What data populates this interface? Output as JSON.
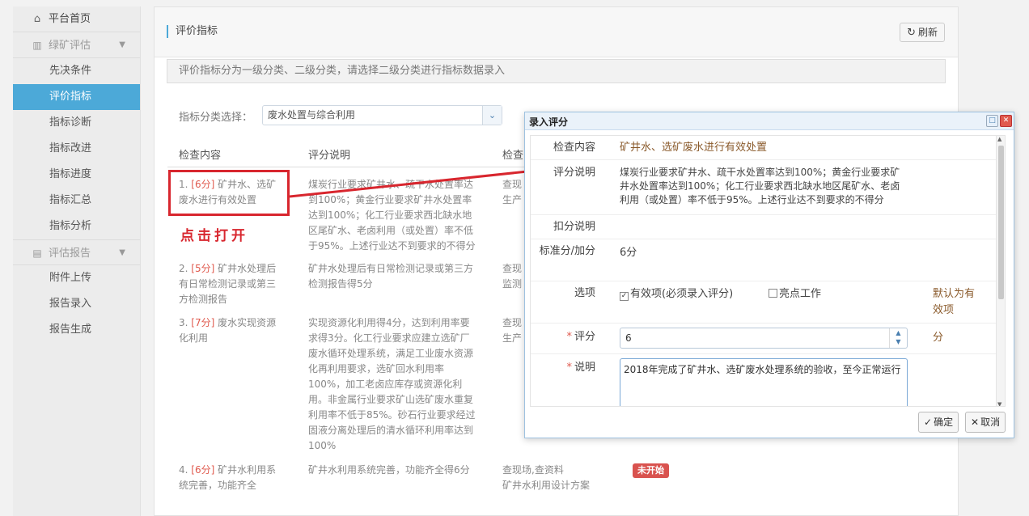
{
  "sidebar": {
    "home": "平台首页",
    "group1": "绿矿评估",
    "group1_items": [
      "先决条件",
      "评价指标",
      "指标诊断",
      "指标改进",
      "指标进度",
      "指标汇总",
      "指标分析"
    ],
    "group2": "评估报告",
    "group2_items": [
      "附件上传",
      "报告录入",
      "报告生成"
    ],
    "active_item": "评价指标"
  },
  "main": {
    "title": "评价指标",
    "refresh_label": "刷新",
    "notice": "评价指标分为一级分类、二级分类，请选择二级分类进行指标数据录入",
    "filter_label": "指标分类选择：",
    "filter_value": "废水处置与综合利用",
    "columns": [
      "检查内容",
      "评分说明",
      "检查"
    ],
    "rows": [
      {
        "num": "1.",
        "score": "[6分]",
        "content": "矿井水、选矿废水进行有效处置",
        "desc": "煤炭行业要求矿井水、疏干水处置率达到100%；黄金行业要求矿井水处置率达到100%；化工行业要求西北缺水地区尾矿水、老卤利用（或处置）率不低于95%。上述行业达不到要求的不得分",
        "check": "查现",
        "check2": "生产"
      },
      {
        "num": "2.",
        "score": "[5分]",
        "content": "矿井水处理后有日常检测记录或第三方检测报告",
        "desc": "矿井水处理后有日常检测记录或第三方检测报告得5分",
        "check": "查现",
        "check2": "监测"
      },
      {
        "num": "3.",
        "score": "[7分]",
        "content": "废水实现资源化利用",
        "desc": "实现资源化利用得4分，达到利用率要求得3分。化工行业要求应建立选矿厂废水循环处理系统，满足工业废水资源化再利用要求，选矿回水利用率100%，加工老卤应库存或资源化利用。非金属行业要求矿山选矿废水重复利用率不低于85%。砂石行业要求经过固液分离处理后的清水循环利用率达到100%",
        "check": "查现",
        "check2": "生产"
      },
      {
        "num": "4.",
        "score": "[6分]",
        "content": "矿井水利用系统完善，功能齐全",
        "desc": "矿井水利用系统完善，功能齐全得6分",
        "check": "查现场,查资料",
        "check2": "矿井水利用设计方案",
        "status": "未开始"
      }
    ],
    "annotation": "点击打开"
  },
  "modal": {
    "title": "录入评分",
    "labels": {
      "content": "检查内容",
      "desc": "评分说明",
      "deduct": "扣分说明",
      "standard": "标准分/加分",
      "options": "选项",
      "score": "评分",
      "explain": "说明"
    },
    "content": "矿井水、选矿废水进行有效处置",
    "desc": "煤炭行业要求矿井水、疏干水处置率达到100%；黄金行业要求矿井水处置率达到100%；化工行业要求西北缺水地区尾矿水、老卤利用（或处置）率不低于95%。上述行业达不到要求的不得分",
    "deduct": "",
    "standard": "6分",
    "option_valid": "有效项(必须录入评分)",
    "option_highlight": "亮点工作",
    "option_hint": "默认为有效项",
    "score_value": "6",
    "score_unit": "分",
    "explain_value": "2018年完成了矿井水、选矿废水处理系统的验收，至今正常运行",
    "ok_label": "确定",
    "cancel_label": "取消"
  },
  "colors": {
    "accent": "#4ca9d8",
    "annotation": "#d8262e",
    "score": "#e05a4e"
  }
}
